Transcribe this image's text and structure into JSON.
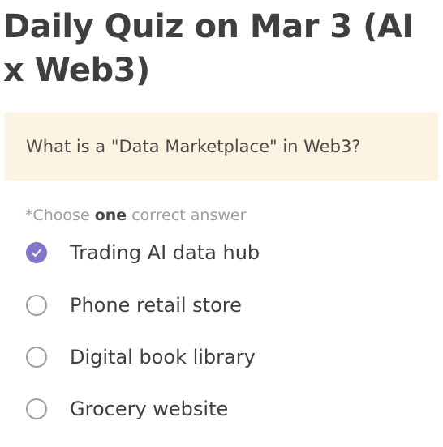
{
  "quiz": {
    "title": "Daily Quiz on Mar 3 (AI x Web3)",
    "question": "What is a \"Data Marketplace\" in Web3?",
    "instruction": {
      "prefix": "*Choose ",
      "emphasis": "one",
      "suffix": " correct answer"
    },
    "options": [
      {
        "label": "Trading AI data hub",
        "selected": true
      },
      {
        "label": "Phone retail store",
        "selected": false
      },
      {
        "label": "Digital book library",
        "selected": false
      },
      {
        "label": "Grocery website",
        "selected": false
      }
    ],
    "colors": {
      "accent": "#8176c7",
      "question_bg": "#fdf3e3",
      "radio_border": "#9e9e9e"
    },
    "icons": {
      "selected": "check-icon"
    }
  }
}
